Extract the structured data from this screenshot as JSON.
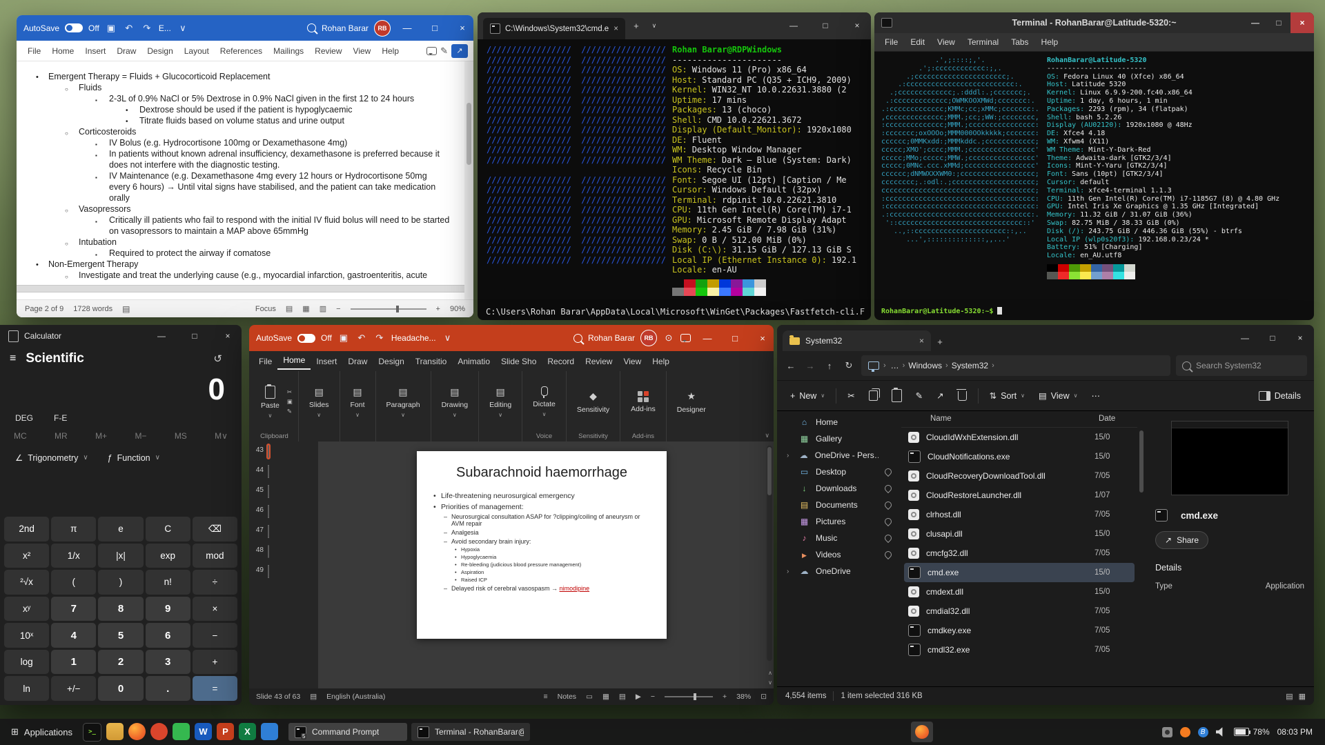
{
  "word": {
    "title": {
      "autosave": "AutoSave",
      "autosave_state": "Off",
      "doc_name": "E...",
      "user": "Rohan Barar",
      "avatar": "RB"
    },
    "tabs": [
      "File",
      "Home",
      "Insert",
      "Draw",
      "Design",
      "Layout",
      "References",
      "Mailings",
      "Review",
      "View",
      "Help"
    ],
    "doc_lines": [
      {
        "level": 1,
        "marker": "•",
        "text": "Emergent Therapy = Fluids + Glucocorticoid Replacement"
      },
      {
        "level": 2,
        "marker": "○",
        "text": "Fluids"
      },
      {
        "level": 3,
        "marker": "▪",
        "text": "2-3L of 0.9% NaCl or 5% Dextrose in 0.9% NaCl given in the first 12 to 24 hours"
      },
      {
        "level": 4,
        "marker": "•",
        "text": "Dextrose should be used if the patient is hypoglycaemic"
      },
      {
        "level": 4,
        "marker": "•",
        "text": "Titrate fluids based on volume status and urine output"
      },
      {
        "level": 2,
        "marker": "○",
        "text": "Corticosteroids"
      },
      {
        "level": 3,
        "marker": "▪",
        "text": "IV Bolus (e.g. Hydrocortisone 100mg or Dexamethasone 4mg)"
      },
      {
        "level": 3,
        "marker": "▪",
        "text": "In patients without known adrenal insufficiency, dexamethasone is preferred because it does not interfere with the diagnostic testing."
      },
      {
        "level": 3,
        "marker": "▪",
        "text": "IV Maintenance (e.g. Dexamethasone 4mg every 12 hours or Hydrocortisone 50mg every 6 hours) → Until vital signs have stabilised, and the patient can take medication orally"
      },
      {
        "level": 2,
        "marker": "○",
        "text": "Vasopressors"
      },
      {
        "level": 3,
        "marker": "▪",
        "text": "Critically ill patients who fail to respond with the initial IV fluid bolus will need to be started on vasopressors to maintain a MAP above 65mmHg"
      },
      {
        "level": 2,
        "marker": "○",
        "text": "Intubation"
      },
      {
        "level": 3,
        "marker": "▪",
        "text": "Required to protect the airway if comatose"
      },
      {
        "level": 1,
        "marker": "•",
        "text": "Non-Emergent Therapy"
      },
      {
        "level": 2,
        "marker": "○",
        "text": "Investigate and treat the underlying cause (e.g., myocardial infarction, gastroenteritis, acute"
      }
    ],
    "status": {
      "page": "Page 2 of 9",
      "words": "1728 words",
      "focus": "Focus",
      "zoom": "90%"
    }
  },
  "cmd": {
    "tab_title": "C:\\Windows\\System32\\cmd.e",
    "logo": [
      "/////////////////  /////////////////",
      "/////////////////  /////////////////",
      "/////////////////  /////////////////",
      "/////////////////  /////////////////",
      "/////////////////  /////////////////",
      "/////////////////  /////////////////",
      "/////////////////  /////////////////",
      "/////////////////  /////////////////",
      "/////////////////  /////////////////",
      "/////////////////  /////////////////",
      "/////////////////  /////////////////",
      "/////////////////  /////////////////",
      "",
      "/////////////////  /////////////////",
      "/////////////////  /////////////////",
      "/////////////////  /////////////////",
      "/////////////////  /////////////////",
      "/////////////////  /////////////////",
      "/////////////////  /////////////////",
      "/////////////////  /////////////////",
      "/////////////////  /////////////////",
      "/////////////////  /////////////////"
    ],
    "header": "Rohan Barar@RDPWindows",
    "separator": "----------------------",
    "info": [
      {
        "k": "OS:",
        "v": "Windows 11 (Pro) x86_64"
      },
      {
        "k": "Host:",
        "v": "Standard PC (Q35 + ICH9, 2009)"
      },
      {
        "k": "Kernel:",
        "v": "WIN32_NT 10.0.22631.3880 (2"
      },
      {
        "k": "Uptime:",
        "v": "17 mins"
      },
      {
        "k": "Packages:",
        "v": "13 (choco)"
      },
      {
        "k": "Shell:",
        "v": "CMD 10.0.22621.3672"
      },
      {
        "k": "Display (Default_Monitor):",
        "v": "1920x1080"
      },
      {
        "k": "DE:",
        "v": "Fluent"
      },
      {
        "k": "WM:",
        "v": "Desktop Window Manager"
      },
      {
        "k": "WM Theme:",
        "v": "Dark – Blue (System: Dark)"
      },
      {
        "k": "Icons:",
        "v": "Recycle Bin"
      },
      {
        "k": "Font:",
        "v": "Segoe UI (12pt) [Caption / Me"
      },
      {
        "k": "Cursor:",
        "v": "Windows Default (32px)"
      },
      {
        "k": "Terminal:",
        "v": "rdpinit 10.0.22621.3810"
      },
      {
        "k": "CPU:",
        "v": "11th Gen Intel(R) Core(TM) i7-1"
      },
      {
        "k": "GPU:",
        "v": "Microsoft Remote Display Adapt"
      },
      {
        "k": "Memory:",
        "v": "2.45 GiB / 7.98 GiB (31%)"
      },
      {
        "k": "Swap:",
        "v": "0 B / 512.00 MiB (0%)"
      },
      {
        "k": "Disk (C:\\):",
        "v": "31.15 GiB / 127.13 GiB S"
      },
      {
        "k": "Local IP (Ethernet Instance 0):",
        "v": "192.1"
      },
      {
        "k": "Locale:",
        "v": "en-AU"
      }
    ],
    "palette": [
      "#0c0c0c",
      "#c50f1f",
      "#13a10e",
      "#c19c00",
      "#0037da",
      "#881798",
      "#3a96dd",
      "#cccccc"
    ],
    "palette_bright": [
      "#767676",
      "#e74856",
      "#16c60c",
      "#f9f1a5",
      "#3b78ff",
      "#b4009e",
      "#61d6d6",
      "#f2f2f2"
    ],
    "cwd": "C:\\Users\\Rohan Barar\\AppData\\Local\\Microsoft\\WinGet\\Packages\\Fastfetch-cli.F"
  },
  "terminal": {
    "title": "Terminal - RohanBarar@Latitude-5320:~",
    "menu": [
      "File",
      "Edit",
      "View",
      "Terminal",
      "Tabs",
      "Help"
    ],
    "logo": [
      "             .',;::::;,'.",
      "         .';:cccccccccccc:;,.",
      "      .;cccccccccccccccccccccc;.",
      "    .:cccccccccccccccccccccccccc:.",
      "  .;ccccccccccccc;.:dddl:.;ccccccc;.",
      " .:ccccccccccccc;OWMKOOXMWd;ccccccc:.",
      ".:ccccccccccccc;KMMc;cc;xMMc;ccccccc:.",
      ",cccccccccccccc;MMM.;cc;;WW:;cccccccc,",
      ":cccccccccccccc;MMM.;cccccccccccccccc:",
      ":ccccccc;oxOOOo;MMM000OOkkkkk;ccccccc:",
      "cccccc;0MMKxdd:;MMMkddc.;cccccccccccc;",
      "ccccc;XMO';cccc;MMM.;cccccccccccccccc'",
      "ccccc;MMo;ccccc;MMW.;cccccccccccccccc'",
      "ccccc;0MNc.ccc.xMMd;ccccccccccccccccc'",
      "cccccc;dNMWXXXWM0:;cccccccccccccccccc;",
      "cccccccc;.:odl:.;cccccccccccccccccccc;",
      "ccccccccccccccccccccccccccccccccccccc;",
      ":cccccccccccccccccccccccccccccccccccc:",
      ":cccccccccccccccccccccccccccccccccccc:",
      ".:cccccccccccccccccccccccccccccccccc:.",
      " '::cccccccccccccccccccccccccccccc::'",
      "   ..,::cccccccccccccccccccccc::,..",
      "      ...',::::::::::::::,,...'"
    ],
    "header": "RohanBarar@Latitude-5320",
    "separator": "------------------------",
    "info": [
      {
        "k": "OS:",
        "v": "Fedora Linux 40 (Xfce) x86_64"
      },
      {
        "k": "Host:",
        "v": "Latitude 5320"
      },
      {
        "k": "Kernel:",
        "v": "Linux 6.9.9-200.fc40.x86_64"
      },
      {
        "k": "Uptime:",
        "v": "1 day, 6 hours, 1 min"
      },
      {
        "k": "Packages:",
        "v": "2293 (rpm), 34 (flatpak)"
      },
      {
        "k": "Shell:",
        "v": "bash 5.2.26"
      },
      {
        "k": "Display (AU02120):",
        "v": "1920x1080 @ 48Hz"
      },
      {
        "k": "DE:",
        "v": "Xfce4 4.18"
      },
      {
        "k": "WM:",
        "v": "Xfwm4 (X11)"
      },
      {
        "k": "WM Theme:",
        "v": "Mint-Y-Dark-Red"
      },
      {
        "k": "Theme:",
        "v": "Adwaita-dark [GTK2/3/4]"
      },
      {
        "k": "Icons:",
        "v": "Mint-Y-Yaru [GTK2/3/4]"
      },
      {
        "k": "Font:",
        "v": "Sans (10pt) [GTK2/3/4]"
      },
      {
        "k": "Cursor:",
        "v": "default"
      },
      {
        "k": "Terminal:",
        "v": "xfce4-terminal 1.1.3"
      },
      {
        "k": "CPU:",
        "v": "11th Gen Intel(R) Core(TM) i7-1185G7 (8) @ 4.80 GHz"
      },
      {
        "k": "GPU:",
        "v": "Intel Iris Xe Graphics @ 1.35 GHz [Integrated]"
      },
      {
        "k": "Memory:",
        "v": "11.32 GiB / 31.07 GiB (36%)"
      },
      {
        "k": "Swap:",
        "v": "82.75 MiB / 38.33 GiB (0%)"
      },
      {
        "k": "Disk (/):",
        "v": "243.75 GiB / 446.36 GiB (55%) - btrfs"
      },
      {
        "k": "Local IP (wlp0s20f3):",
        "v": "192.168.0.23/24 *"
      },
      {
        "k": "Battery:",
        "v": "51% [Charging]"
      },
      {
        "k": "Locale:",
        "v": "en_AU.utf8"
      }
    ],
    "palette": [
      "#000000",
      "#cc0000",
      "#4e9a06",
      "#c4a000",
      "#3465a4",
      "#75507b",
      "#06989a",
      "#d3d7cf"
    ],
    "palette_bright": [
      "#555753",
      "#ef2929",
      "#8ae234",
      "#fce94f",
      "#729fcf",
      "#ad7fa8",
      "#34e2e2",
      "#eeeeec"
    ],
    "prompt": "RohanBarar@Latitude-5320:~$"
  },
  "calculator": {
    "title": "Calculator",
    "mode": "Scientific",
    "display": "0",
    "angle_button": "DEG",
    "fe_button": "F-E",
    "memory": [
      "MC",
      "MR",
      "M+",
      "M−",
      "MS",
      "M∨"
    ],
    "trig_icon": "∠",
    "trig_label": "Trigonometry",
    "func_icon": "ƒ",
    "func_label": "Function",
    "keys": [
      {
        "l": "2nd",
        "t": "fn"
      },
      {
        "l": "π",
        "t": "fn"
      },
      {
        "l": "e",
        "t": "fn"
      },
      {
        "l": "C",
        "t": "fn"
      },
      {
        "l": "⌫",
        "t": "fn"
      },
      {
        "l": "x²",
        "t": "fn"
      },
      {
        "l": "1/x",
        "t": "fn"
      },
      {
        "l": "|x|",
        "t": "fn"
      },
      {
        "l": "exp",
        "t": "fn"
      },
      {
        "l": "mod",
        "t": "fn"
      },
      {
        "l": "²√x",
        "t": "fn"
      },
      {
        "l": "(",
        "t": "fn"
      },
      {
        "l": ")",
        "t": "fn"
      },
      {
        "l": "n!",
        "t": "fn"
      },
      {
        "l": "÷",
        "t": "fn"
      },
      {
        "l": "xʸ",
        "t": "fn"
      },
      {
        "l": "7",
        "t": "num"
      },
      {
        "l": "8",
        "t": "num"
      },
      {
        "l": "9",
        "t": "num"
      },
      {
        "l": "×",
        "t": "fn"
      },
      {
        "l": "10ˣ",
        "t": "fn"
      },
      {
        "l": "4",
        "t": "num"
      },
      {
        "l": "5",
        "t": "num"
      },
      {
        "l": "6",
        "t": "num"
      },
      {
        "l": "−",
        "t": "fn"
      },
      {
        "l": "log",
        "t": "fn"
      },
      {
        "l": "1",
        "t": "num"
      },
      {
        "l": "2",
        "t": "num"
      },
      {
        "l": "3",
        "t": "num"
      },
      {
        "l": "+",
        "t": "fn"
      },
      {
        "l": "ln",
        "t": "fn"
      },
      {
        "l": "+/−",
        "t": "fn"
      },
      {
        "l": "0",
        "t": "num"
      },
      {
        "l": ".",
        "t": "num"
      },
      {
        "l": "=",
        "t": "eq"
      }
    ]
  },
  "powerpoint": {
    "title": {
      "autosave": "AutoSave",
      "autosave_state": "Off",
      "doc_name": "Headache...",
      "user": "Rohan Barar",
      "avatar": "RB"
    },
    "tabs": [
      {
        "l": "File"
      },
      {
        "l": "Home",
        "s": "active"
      },
      {
        "l": "Insert"
      },
      {
        "l": "Draw"
      },
      {
        "l": "Design"
      },
      {
        "l": "Transitio"
      },
      {
        "l": "Animatio"
      },
      {
        "l": "Slide Sho"
      },
      {
        "l": "Record"
      },
      {
        "l": "Review"
      },
      {
        "l": "View"
      },
      {
        "l": "Help"
      }
    ],
    "ribbon": {
      "paste": "Paste",
      "clipboard_group": "Clipboard",
      "big_buttons": [
        "Slides",
        "Font",
        "Paragraph",
        "Drawing",
        "Editing"
      ],
      "dictate": "Dictate",
      "voice_group": "Voice",
      "sensitivity": "Sensitivity",
      "sensitivity_group": "Sensitivity",
      "addins": "Add-ins",
      "addins_group": "Add-ins",
      "designer": "Designer"
    },
    "thumbnails": [
      {
        "n": "43",
        "s": "selected"
      },
      {
        "n": "44"
      },
      {
        "n": "45"
      },
      {
        "n": "46"
      },
      {
        "n": "47"
      },
      {
        "n": "48",
        "im": "y"
      },
      {
        "n": "49"
      }
    ],
    "slide": {
      "title": "Subarachnoid haemorrhage",
      "bullets": [
        {
          "level": 1,
          "marker": "•",
          "text": "Life-threatening neurosurgical emergency"
        },
        {
          "level": 1,
          "marker": "•",
          "text": "Priorities of management:"
        },
        {
          "level": 2,
          "marker": "–",
          "text": "Neurosurgical consultation ASAP for ?clipping/coiling of aneurysm or AVM repair"
        },
        {
          "level": 2,
          "marker": "–",
          "text": "Analgesia"
        },
        {
          "level": 2,
          "marker": "–",
          "text": "Avoid secondary brain injury:"
        },
        {
          "level": 3,
          "marker": "•",
          "text": "Hypoxia"
        },
        {
          "level": 3,
          "marker": "•",
          "text": "Hypoglycaemia"
        },
        {
          "level": 3,
          "marker": "•",
          "text": "Re-bleeding (judicious blood pressure management)"
        },
        {
          "level": 3,
          "marker": "•",
          "text": "Aspiration"
        },
        {
          "level": 3,
          "marker": "•",
          "text": "Raised ICP"
        },
        {
          "level": 2,
          "marker": "–",
          "text": "Delayed risk of cerebral vasospasm → ",
          "link": "nimodipine"
        }
      ]
    },
    "status": {
      "slide": "Slide 43 of 63",
      "lang": "English (Australia)",
      "notes": "Notes",
      "zoom": "38%"
    }
  },
  "explorer": {
    "tab": "System32",
    "breadcrumb": [
      "…",
      "Windows",
      "System32"
    ],
    "search_placeholder": "Search System32",
    "toolbar": {
      "new": "New",
      "sort": "Sort",
      "view": "View",
      "details": "Details"
    },
    "sidebar": [
      {
        "label": "Home",
        "icon": "home"
      },
      {
        "label": "Gallery",
        "icon": "gallery"
      },
      {
        "label": "OneDrive - Pers…",
        "icon": "cloud",
        "chev": "y"
      },
      {
        "label": "Desktop",
        "icon": "desktop",
        "pin": "y"
      },
      {
        "label": "Downloads",
        "icon": "downloads",
        "pin": "y"
      },
      {
        "label": "Documents",
        "icon": "documents",
        "pin": "y"
      },
      {
        "label": "Pictures",
        "icon": "pictures",
        "pin": "y"
      },
      {
        "label": "Music",
        "icon": "music",
        "pin": "y"
      },
      {
        "label": "Videos",
        "icon": "videos",
        "pin": "y"
      },
      {
        "label": "OneDrive",
        "icon": "cloud",
        "chev": "y"
      }
    ],
    "columns": {
      "name": "Name",
      "date": "Date"
    },
    "files": [
      {
        "name": "CloudIdWxhExtension.dll",
        "date": "15/0",
        "kind": "dll"
      },
      {
        "name": "CloudNotifications.exe",
        "date": "15/0",
        "kind": "exe"
      },
      {
        "name": "CloudRecoveryDownloadTool.dll",
        "date": "7/05",
        "kind": "dll"
      },
      {
        "name": "CloudRestoreLauncher.dll",
        "date": "1/07",
        "kind": "dll"
      },
      {
        "name": "clrhost.dll",
        "date": "7/05",
        "kind": "dll"
      },
      {
        "name": "clusapi.dll",
        "date": "15/0",
        "kind": "dll"
      },
      {
        "name": "cmcfg32.dll",
        "date": "7/05",
        "kind": "dll"
      },
      {
        "name": "cmd.exe",
        "date": "15/0",
        "kind": "exe",
        "state": "selectedrow"
      },
      {
        "name": "cmdext.dll",
        "date": "15/0",
        "kind": "dll"
      },
      {
        "name": "cmdial32.dll",
        "date": "7/05",
        "kind": "dll"
      },
      {
        "name": "cmdkey.exe",
        "date": "7/05",
        "kind": "exe"
      },
      {
        "name": "cmdl32.exe",
        "date": "7/05",
        "kind": "exe"
      }
    ],
    "preview": {
      "name": "cmd.exe",
      "share": "Share",
      "details": "Details",
      "type_label": "Type",
      "type_value": "Application"
    },
    "status": {
      "items": "4,554 items",
      "selection": "1 item selected 316 KB"
    }
  },
  "taskbar": {
    "applications": "Applications",
    "launchers": [
      {
        "n": "terminal"
      },
      {
        "n": "files"
      },
      {
        "n": "firefox"
      },
      {
        "n": "media"
      },
      {
        "n": "chat"
      },
      {
        "n": "word"
      },
      {
        "n": "powerpoint"
      },
      {
        "n": "excel"
      },
      {
        "n": "remote"
      }
    ],
    "windows": [
      {
        "label": "Command Prompt",
        "s": "active",
        "badge": "5"
      },
      {
        "label": "Terminal - RohanBarar@L…"
      }
    ],
    "tray": {
      "battery": "78%",
      "clock": "08:03 PM"
    }
  }
}
